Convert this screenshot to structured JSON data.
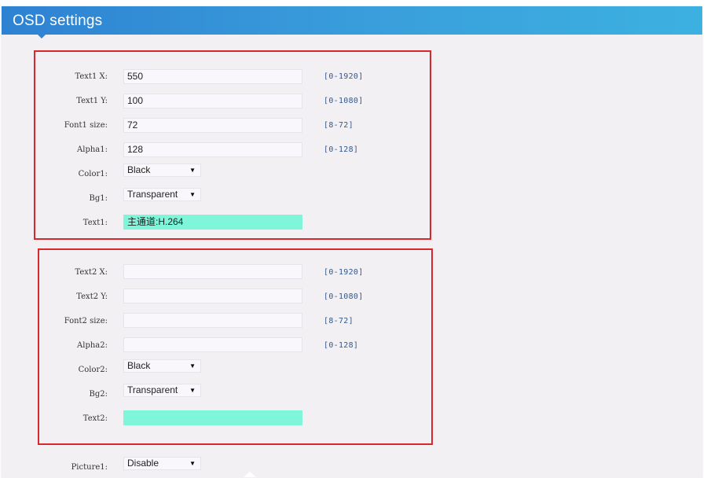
{
  "header": {
    "title": "OSD settings"
  },
  "group1": {
    "rows": [
      {
        "label": "Text1 X:",
        "value": "550",
        "range": "[0-1920]"
      },
      {
        "label": "Text1 Y:",
        "value": "100",
        "range": "[0-1080]"
      },
      {
        "label": "Font1 size:",
        "value": "72",
        "range": "[8-72]"
      },
      {
        "label": "Alpha1:",
        "value": "128",
        "range": "[0-128]"
      }
    ],
    "color": {
      "label": "Color1:",
      "value": "Black"
    },
    "bg": {
      "label": "Bg1:",
      "value": "Transparent"
    },
    "text": {
      "label": "Text1:",
      "value": "主通道:H.264"
    }
  },
  "group2": {
    "rows": [
      {
        "label": "Text2 X:",
        "value": "",
        "range": "[0-1920]"
      },
      {
        "label": "Text2 Y:",
        "value": "",
        "range": "[0-1080]"
      },
      {
        "label": "Font2 size:",
        "value": "",
        "range": "[8-72]"
      },
      {
        "label": "Alpha2:",
        "value": "",
        "range": "[0-128]"
      }
    ],
    "color": {
      "label": "Color2:",
      "value": "Black"
    },
    "bg": {
      "label": "Bg2:",
      "value": "Transparent"
    },
    "text": {
      "label": "Text2:",
      "value": ""
    }
  },
  "picture": {
    "label": "Picture1:",
    "value": "Disable"
  },
  "icons": {
    "caret": "▼"
  },
  "colors": {
    "header_start": "#2e82d2",
    "header_end": "#3cb1e0",
    "highlight_border": "#d8282e",
    "text_field_fill": "#7ff5d9",
    "range_text": "#34598c"
  }
}
